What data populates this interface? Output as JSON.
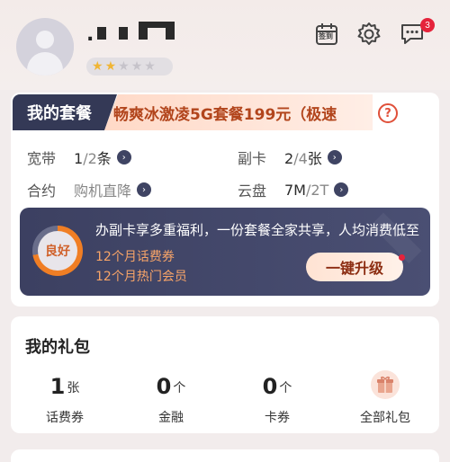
{
  "header": {
    "username": ". ",
    "stars_filled": 2,
    "stars_total": 6,
    "checkin_label": "签到",
    "message_badge": "3"
  },
  "plan": {
    "tag": "我的套餐",
    "name": "畅爽冰激凌5G套餐199元（极速",
    "stats": [
      {
        "label": "宽带",
        "value_main": "1",
        "value_dim": "/2",
        "value_suffix": "条"
      },
      {
        "label": "副卡",
        "value_main": "2",
        "value_dim": "/4",
        "value_suffix": "张"
      },
      {
        "label": "合约",
        "value": "购机直降"
      },
      {
        "label": "云盘",
        "value_main": "7M",
        "value_dim": "/2T",
        "value_suffix": ""
      }
    ]
  },
  "promo": {
    "ring_label": "良好",
    "headline": "办副卡享多重福利，一份套餐全家共享，人均消费低至",
    "line1": "12个月话费券",
    "line2": "12个月热门会员",
    "button": "一键升级"
  },
  "gifts": {
    "title": "我的礼包",
    "items": [
      {
        "num": "1",
        "unit": "张",
        "label": "话费券"
      },
      {
        "num": "0",
        "unit": "个",
        "label": "金融"
      },
      {
        "num": "0",
        "unit": "个",
        "label": "卡券"
      },
      {
        "label": "全部礼包"
      }
    ]
  },
  "colors": {
    "accent": "#f07e24",
    "plan_tag_bg": "#343956",
    "badge": "#e5233b"
  }
}
